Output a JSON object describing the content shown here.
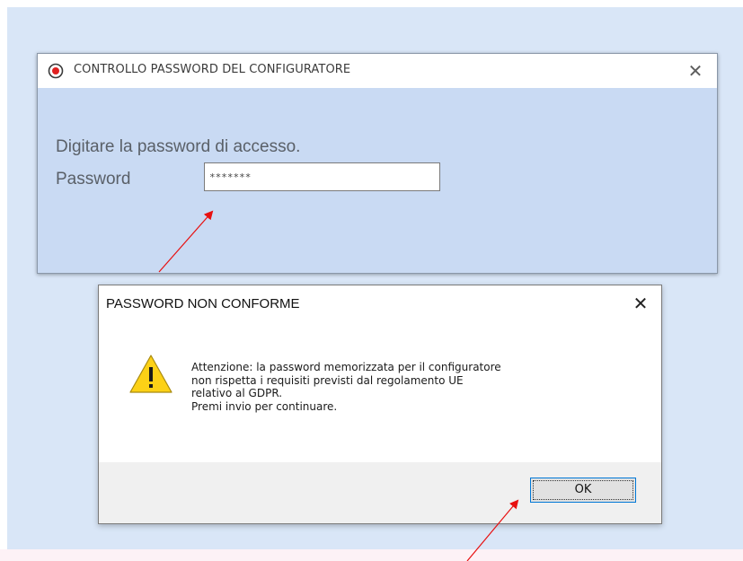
{
  "config_window": {
    "title": "CONTROLLO PASSWORD DEL CONFIGURATORE",
    "close_glyph": "✕",
    "prompt": "Digitare la password di accesso.",
    "password_label": "Password",
    "password_value": "*******",
    "icon": "app-record-icon"
  },
  "dialog": {
    "title": "PASSWORD NON CONFORME",
    "close_glyph": "✕",
    "icon": "warning-icon",
    "message_lines": [
      "Attenzione: la password memorizzata per il configuratore",
      "non rispetta i requisiti previsti dal regolamento UE",
      "relativo al GDPR.",
      "Premi invio per continuare."
    ],
    "ok_label": "OK"
  },
  "colors": {
    "backdrop": "#d9e6f7",
    "window_body": "#c9daf3",
    "annotation_arrow": "#e81010",
    "warning_fill": "#fcd116"
  }
}
